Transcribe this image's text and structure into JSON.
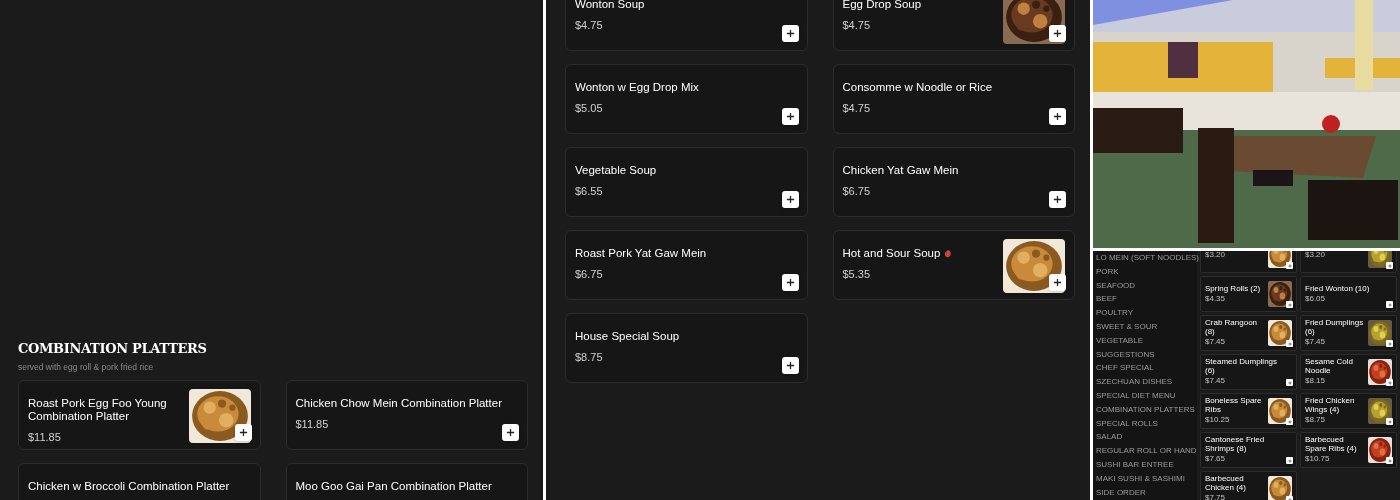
{
  "panel_1": {
    "section": {
      "title": "COMBINATION PLATTERS",
      "subtitle": "served with egg roll & pork fried rice"
    },
    "items": [
      {
        "name": "Roast Pork Egg Foo Young Combination Platter",
        "price": "$11.85",
        "has_photo": true,
        "spicy": false
      },
      {
        "name": "Chicken Chow Mein Combination Platter",
        "price": "$11.85",
        "has_photo": false,
        "spicy": false
      },
      {
        "name": "Chicken w Broccoli Combination Platter",
        "has_photo": false,
        "spicy": false
      },
      {
        "name": "Moo Goo Gai Pan Combination Platter",
        "has_photo": false,
        "spicy": false
      }
    ]
  },
  "panel_2": {
    "items": [
      {
        "name": "Wonton Soup",
        "price": "$4.75",
        "has_photo": false,
        "spicy": false
      },
      {
        "name": "Egg Drop Soup",
        "price": "$4.75",
        "has_photo": true,
        "spicy": false
      },
      {
        "name": "Wonton w Egg Drop Mix",
        "price": "$5.05",
        "has_photo": false,
        "spicy": false
      },
      {
        "name": "Consomme w Noodle or Rice",
        "price": "$4.75",
        "has_photo": false,
        "spicy": false
      },
      {
        "name": "Vegetable Soup",
        "price": "$6.55",
        "has_photo": false,
        "spicy": false
      },
      {
        "name": "Chicken Yat Gaw Mein",
        "price": "$6.75",
        "has_photo": false,
        "spicy": false
      },
      {
        "name": "Roast Pork Yat Gaw Mein",
        "price": "$6.75",
        "has_photo": false,
        "spicy": false
      },
      {
        "name": "Hot and Sour Soup",
        "price": "$5.35",
        "has_photo": true,
        "spicy": true
      },
      {
        "name": "House Special Soup",
        "price": "$8.75",
        "has_photo": false,
        "spicy": false
      }
    ]
  },
  "panel_3": {
    "categories": [
      "LO MEIN (SOFT NOODLES)",
      "PORK",
      "SEAFOOD",
      "BEEF",
      "POULTRY",
      "SWEET & SOUR",
      "VEGETABLE",
      "SUGGESTIONS",
      "CHEF SPECIAL",
      "SZECHUAN DISHES",
      "SPECIAL DIET MENU",
      "COMBINATION PLATTERS",
      "SPECIAL ROLLS",
      "SALAD",
      "REGULAR ROLL OR HAND",
      "SUSHI BAR ENTREE",
      "MAKI SUSHI & SASHIMI",
      "SIDE ORDER"
    ],
    "items": [
      {
        "price": "$3.20",
        "has_photo": true
      },
      {
        "price": "$3.20",
        "has_photo": true
      },
      {
        "name": "Spring Rolls (2)",
        "price": "$4.35",
        "has_photo": true
      },
      {
        "name": "Fried Wonton (10)",
        "price": "$6.05",
        "has_photo": false
      },
      {
        "name": "Crab Rangoon (8)",
        "price": "$7.45",
        "has_photo": true
      },
      {
        "name": "Fried Dumplings (6)",
        "price": "$7.45",
        "has_photo": true
      },
      {
        "name": "Steamed Dumplings (6)",
        "price": "$7.45",
        "has_photo": false
      },
      {
        "name": "Sesame Cold Noodle",
        "price": "$8.15",
        "has_photo": true
      },
      {
        "name": "Boneless Spare Ribs",
        "price": "$10.25",
        "has_photo": true
      },
      {
        "name": "Fried Chicken Wings (4)",
        "price": "$8.75",
        "has_photo": true
      },
      {
        "name": "Cantonese Fried Shrimps (8)",
        "price": "$7.65",
        "has_photo": false
      },
      {
        "name": "Barbecued Spare Ribs (4)",
        "price": "$10.75",
        "has_photo": true
      },
      {
        "name": "Barbecued Chicken (4)",
        "price": "$7.75",
        "has_photo": true
      }
    ]
  }
}
